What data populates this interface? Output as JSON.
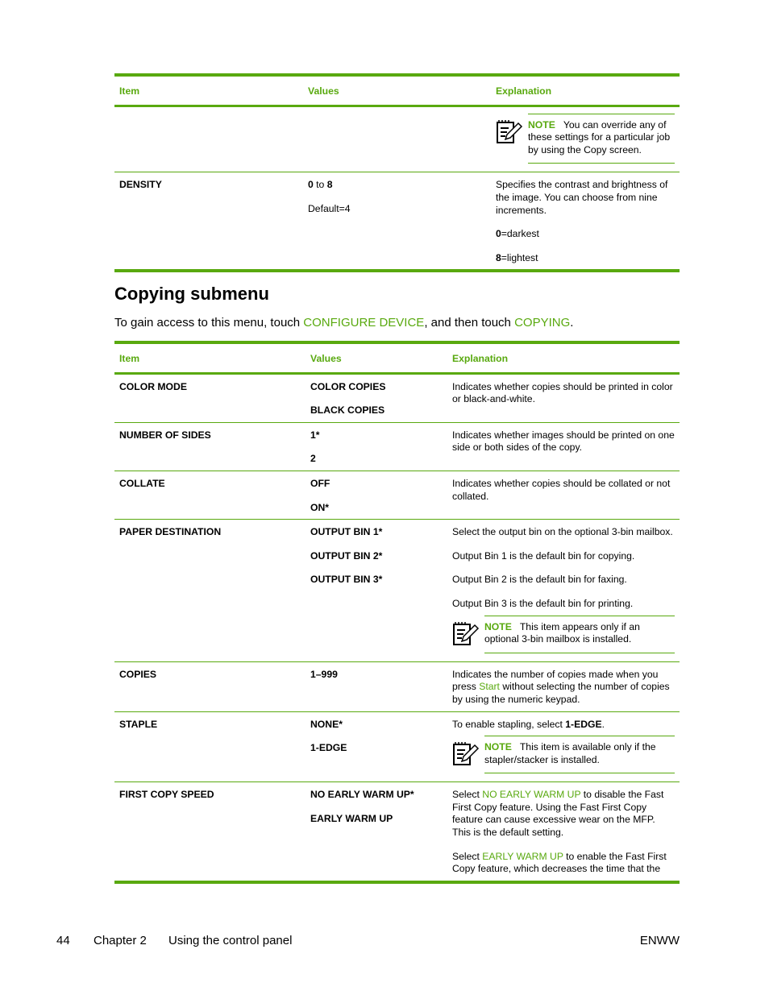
{
  "colors": {
    "accent": "#59a90f",
    "text": "#000000"
  },
  "table1": {
    "headers": {
      "item": "Item",
      "values": "Values",
      "explanation": "Explanation"
    },
    "continued_row": {
      "note": {
        "icon": "note-pencil-icon",
        "label": "NOTE",
        "text": "You can override any of these settings for a particular job by using the Copy screen."
      }
    },
    "density_row": {
      "item": "DENSITY",
      "values_min": "0",
      "values_to": " to ",
      "values_max": "8",
      "values_default": "Default=4",
      "explanation": "Specifies the contrast and brightness of the image. You can choose from nine increments.",
      "darkest_key": "0",
      "darkest_text": "=darkest",
      "lightest_key": "8",
      "lightest_text": "=lightest"
    }
  },
  "section": {
    "title": "Copying submenu",
    "intro_prefix": "To gain access to this menu, touch ",
    "intro_link1": "CONFIGURE DEVICE",
    "intro_middle": ", and then touch ",
    "intro_link2": "COPYING",
    "intro_suffix": "."
  },
  "table2": {
    "headers": {
      "item": "Item",
      "values": "Values",
      "explanation": "Explanation"
    },
    "rows": [
      {
        "item": "COLOR MODE",
        "values": [
          "COLOR COPIES",
          "BLACK COPIES"
        ],
        "explanation": [
          "Indicates whether copies should be printed in color or black-and-white."
        ]
      },
      {
        "item": "NUMBER OF SIDES",
        "values": [
          "1*",
          "2"
        ],
        "explanation": [
          "Indicates whether images should be printed on one side or both sides of the copy."
        ]
      },
      {
        "item": "COLLATE",
        "values": [
          "OFF",
          "ON*"
        ],
        "explanation": [
          "Indicates whether copies should be collated or not collated."
        ]
      },
      {
        "item": "PAPER DESTINATION",
        "values": [
          "OUTPUT BIN 1*",
          "OUTPUT BIN 2*",
          "OUTPUT BIN 3*"
        ],
        "explanation": [
          "Select the output bin on the optional 3-bin mailbox.",
          "Output Bin 1 is the default bin for copying.",
          "Output Bin 2 is the default bin for faxing.",
          "Output Bin 3 is the default bin for printing."
        ],
        "note": {
          "icon": "note-pencil-icon",
          "label": "NOTE",
          "text": "This item appears only if an optional 3-bin mailbox is installed."
        }
      },
      {
        "item": "COPIES",
        "values": [
          "1–999"
        ],
        "explanation_prefix": "Indicates the number of copies made when you press ",
        "explanation_link": "Start",
        "explanation_suffix": " without selecting the number of copies by using the numeric keypad."
      },
      {
        "item": "STAPLE",
        "values": [
          "NONE*",
          "1-EDGE"
        ],
        "explanation_prefix": "To enable stapling, select ",
        "explanation_bold": "1-EDGE",
        "explanation_suffix": ".",
        "note": {
          "icon": "note-pencil-icon",
          "label": "NOTE",
          "text": "This item is available only if the stapler/stacker is installed."
        }
      },
      {
        "item": "FIRST COPY SPEED",
        "values": [
          "NO EARLY WARM UP*",
          "EARLY WARM UP"
        ],
        "exp1_prefix": "Select ",
        "exp1_link": "NO EARLY WARM UP",
        "exp1_suffix": " to disable the Fast First Copy feature. Using the Fast First Copy feature can cause excessive wear on the MFP. This is the default setting.",
        "exp2_prefix": "Select ",
        "exp2_link": "EARLY WARM UP",
        "exp2_suffix": " to enable the Fast First Copy feature, which decreases the time that the"
      }
    ]
  },
  "footer": {
    "page_number": "44",
    "chapter": "Chapter 2",
    "chapter_title": "Using the control panel",
    "locale": "ENWW"
  }
}
